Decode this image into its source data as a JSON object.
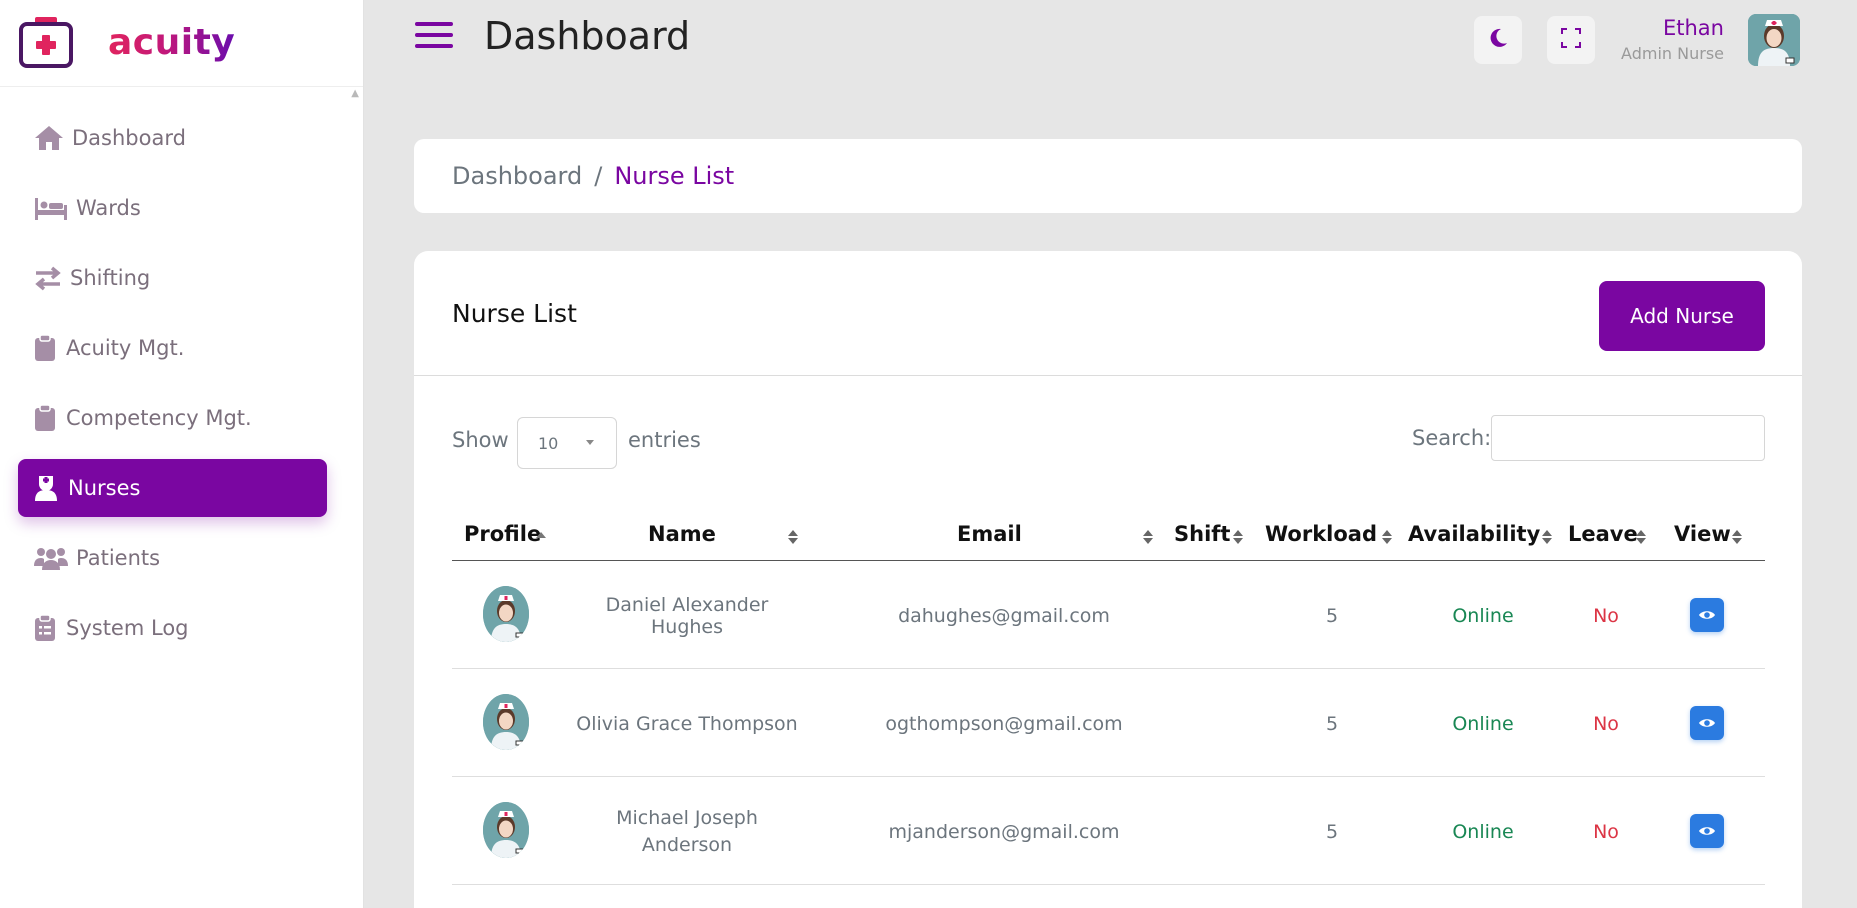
{
  "app": {
    "brand": "acuity",
    "page_title": "Dashboard",
    "accent_color": "#7a06a1"
  },
  "sidebar": {
    "items": [
      {
        "label": "Dashboard",
        "icon": "home-icon",
        "active": false
      },
      {
        "label": "Wards",
        "icon": "bed-icon",
        "active": false
      },
      {
        "label": "Shifting",
        "icon": "swap-arrows-icon",
        "active": false
      },
      {
        "label": "Acuity Mgt.",
        "icon": "clipboard-icon",
        "active": false
      },
      {
        "label": "Competency Mgt.",
        "icon": "clipboard-icon",
        "active": false
      },
      {
        "label": "Nurses",
        "icon": "nurse-icon",
        "active": true
      },
      {
        "label": "Patients",
        "icon": "users-icon",
        "active": false
      },
      {
        "label": "System Log",
        "icon": "clipboard-list-icon",
        "active": false
      }
    ]
  },
  "header": {
    "user_name": "Ethan",
    "user_role": "Admin Nurse"
  },
  "breadcrumb": {
    "home": "Dashboard",
    "separator": "/",
    "current": "Nurse List"
  },
  "card": {
    "title": "Nurse List",
    "add_button": "Add Nurse"
  },
  "table_controls": {
    "show_label": "Show",
    "page_length": "10",
    "entries_label": "entries",
    "search_label": "Search:",
    "search_value": ""
  },
  "table": {
    "columns": [
      "Profile",
      "Name",
      "Email",
      "Shift",
      "Workload",
      "Availability",
      "Leave",
      "View"
    ],
    "rows": [
      {
        "name": "Daniel Alexander Hughes",
        "email": "dahughes@gmail.com",
        "shift": "",
        "workload": "5",
        "availability": "Online",
        "leave": "No"
      },
      {
        "name": "Olivia Grace Thompson",
        "email": "ogthompson@gmail.com",
        "shift": "",
        "workload": "5",
        "availability": "Online",
        "leave": "No"
      },
      {
        "name": "Michael Joseph Anderson",
        "email": "mjanderson@gmail.com",
        "shift": "",
        "workload": "5",
        "availability": "Online",
        "leave": "No"
      }
    ]
  }
}
